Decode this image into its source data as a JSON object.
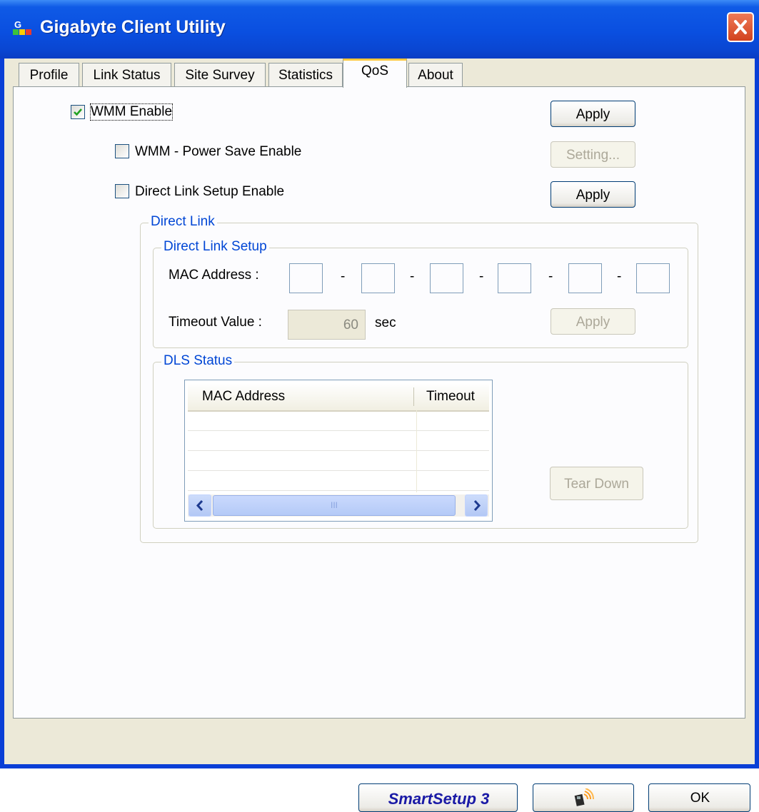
{
  "window": {
    "title": "Gigabyte Client Utility"
  },
  "tabs": [
    {
      "label": "Profile"
    },
    {
      "label": "Link Status"
    },
    {
      "label": "Site Survey"
    },
    {
      "label": "Statistics"
    },
    {
      "label": "QoS"
    },
    {
      "label": "About"
    }
  ],
  "active_tab": "QoS",
  "qos": {
    "wmm_enable": {
      "label": "WMM Enable",
      "checked": true
    },
    "wmm_apply_label": "Apply",
    "wmm_power_save": {
      "label": "WMM - Power Save Enable",
      "checked": false
    },
    "setting_label": "Setting...",
    "dls_enable": {
      "label": "Direct Link Setup Enable",
      "checked": false
    },
    "dls_apply_label": "Apply"
  },
  "direct_link": {
    "group_label": "Direct Link",
    "setup_group_label": "Direct Link Setup",
    "mac_label": "MAC Address :",
    "mac_separator": "-",
    "mac_fields": [
      "",
      "",
      "",
      "",
      "",
      ""
    ],
    "timeout_label": "Timeout Value :",
    "timeout_value": "60",
    "timeout_unit": "sec",
    "apply_label": "Apply",
    "status_group_label": "DLS Status",
    "status_columns": [
      "MAC Address",
      "Timeout"
    ],
    "status_rows": [],
    "scroll_grip": "III",
    "tear_down_label": "Tear Down"
  },
  "footer": {
    "smartsetup_label": "SmartSetup 3",
    "ok_label": "OK"
  },
  "colors": {
    "title_bar": "#0a4fe0",
    "dialog_bg": "#ece9d8",
    "group_label": "#0046d5",
    "active_tab_accent": "#ffc83c",
    "close_button": "#d2421e",
    "smartsetup_text": "#1a1aa6"
  }
}
